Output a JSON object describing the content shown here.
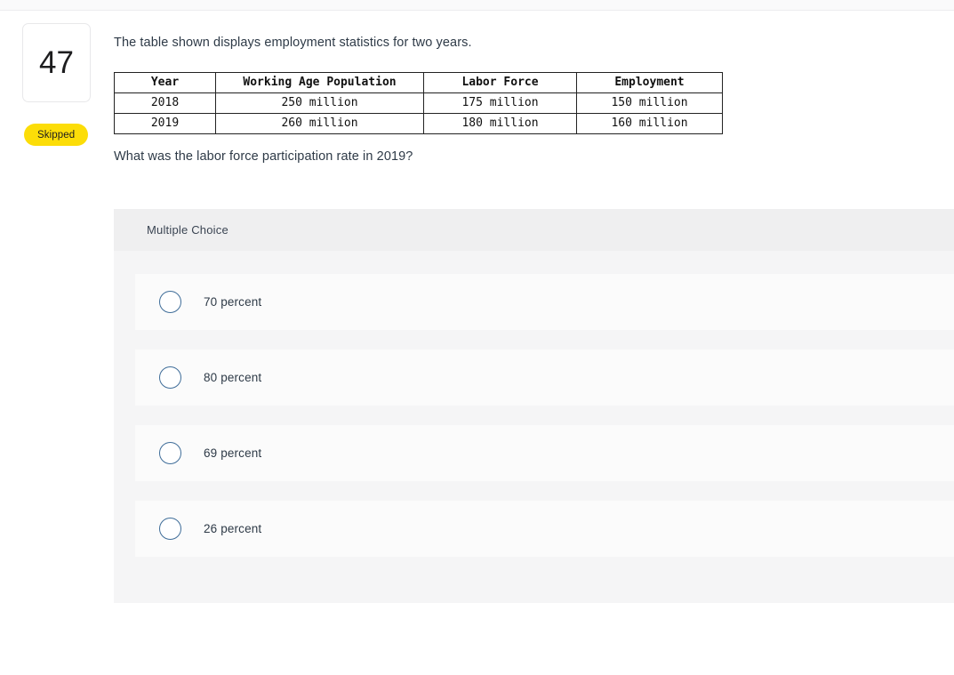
{
  "question": {
    "number": "47",
    "status_badge": "Skipped",
    "intro_text": "The table shown displays employment statistics for two years.",
    "prompt": "What was the labor force participation rate in 2019?"
  },
  "table": {
    "headers": [
      "Year",
      "Working Age Population",
      "Labor Force",
      "Employment"
    ],
    "rows": [
      [
        "2018",
        "250 million",
        "175 million",
        "150 million"
      ],
      [
        "2019",
        "260 million",
        "180 million",
        "160 million"
      ]
    ]
  },
  "answer_panel": {
    "type_label": "Multiple Choice",
    "options": [
      {
        "label": "70 percent",
        "selected": false
      },
      {
        "label": "80 percent",
        "selected": false
      },
      {
        "label": "69 percent",
        "selected": false
      },
      {
        "label": "26 percent",
        "selected": false
      }
    ]
  },
  "colors": {
    "badge_background": "#fcdd08",
    "badge_text": "#1d1d1f",
    "panel_header_background": "#efeff0",
    "panel_background": "#f5f5f6",
    "option_row_background": "#fbfbfb",
    "radio_border": "#3f6d99",
    "body_text": "#2e3a47",
    "table_border": "#222222"
  }
}
